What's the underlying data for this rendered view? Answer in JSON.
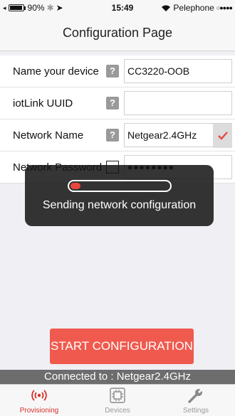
{
  "status_bar": {
    "battery": "90%",
    "time": "15:49",
    "carrier": "Pelephone",
    "signal_dots": "○●●●●"
  },
  "nav": {
    "title": "Configuration Page"
  },
  "form": {
    "rows": [
      {
        "label": "Name your device",
        "value": "CC3220-OOB"
      },
      {
        "label": "iotLink UUID",
        "value": ""
      },
      {
        "label": "Network Name",
        "value": "Netgear2.4GHz"
      },
      {
        "label": "Network Password",
        "value": "●●●●●●●●"
      }
    ],
    "help_glyph": "?"
  },
  "toast": {
    "message": "Sending network configuration",
    "progress": 0.1
  },
  "start_button": {
    "label": "START CONFIGURATION"
  },
  "connection": {
    "text": "Connected to : Netgear2.4GHz"
  },
  "tabs": [
    {
      "label": "Provisioning",
      "icon": "provisioning-icon",
      "active": true
    },
    {
      "label": "Devices",
      "icon": "devices-icon",
      "active": false
    },
    {
      "label": "Settings",
      "icon": "settings-icon",
      "active": false
    }
  ],
  "colors": {
    "accent": "#f05a4e",
    "active_tab": "#d6302a",
    "check": "#e8473e"
  }
}
